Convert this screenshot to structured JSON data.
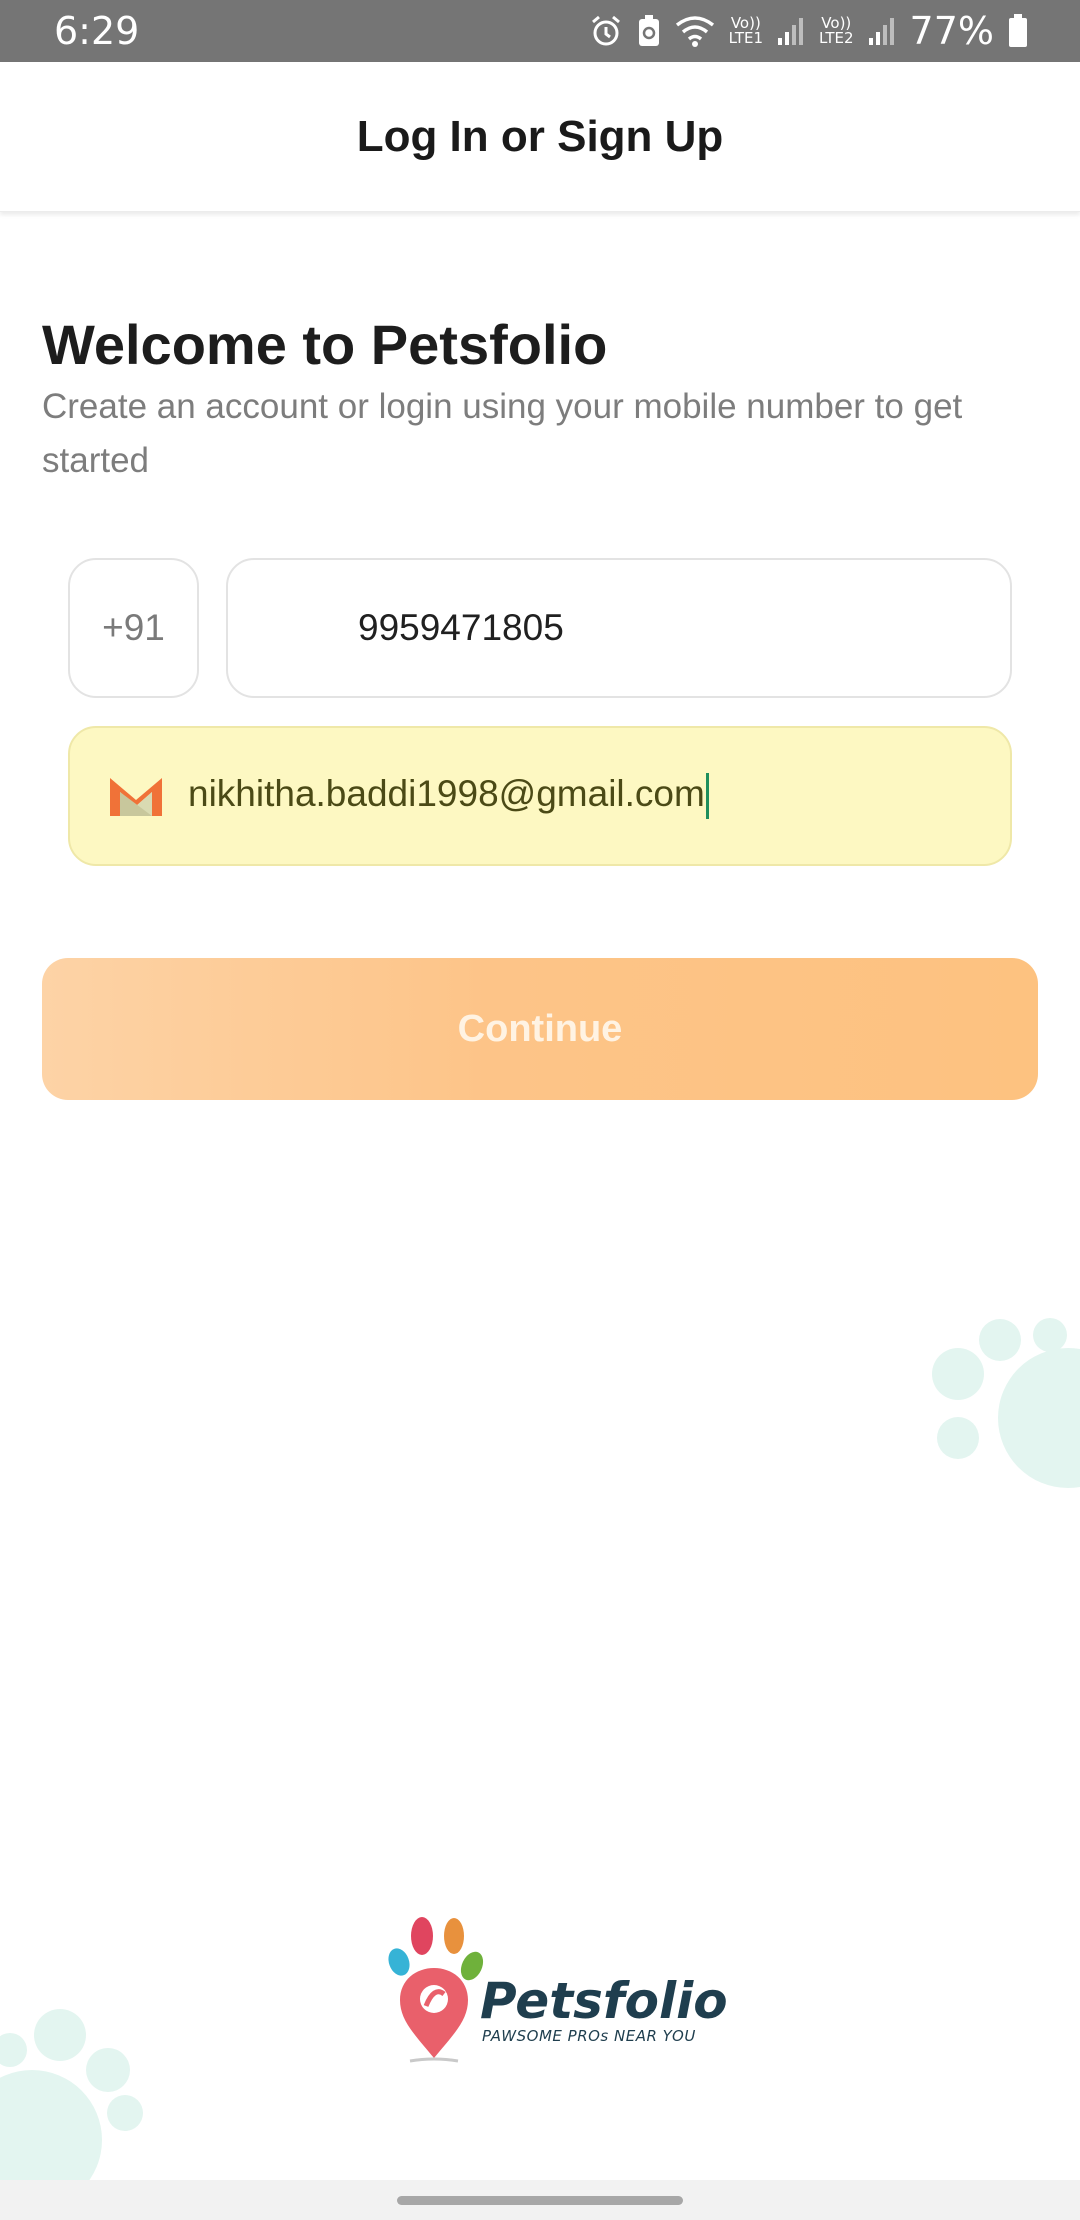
{
  "status_bar": {
    "time": "6:29",
    "sim1_label": "LTE1",
    "sim2_label": "LTE2",
    "volte_label": "Vo))",
    "battery": "77%",
    "icons": [
      "alarm-icon",
      "battery-saver-icon",
      "wifi-icon",
      "signal-icon",
      "battery-icon"
    ]
  },
  "header": {
    "title": "Log In or Sign Up"
  },
  "welcome": {
    "title": "Welcome to Petsfolio",
    "subtitle": "Create an account or login using your mobile number to get started"
  },
  "form": {
    "country_code": "+91",
    "phone": "9959471805",
    "email": "nikhitha.baddi1998@gmail.com",
    "email_icon": "gmail-icon",
    "continue_label": "Continue"
  },
  "logo": {
    "name": "Petsfolio",
    "tagline": "PAWSOME PROs NEAR YOU"
  },
  "colors": {
    "accent": "#fdc488",
    "autofill": "#fdf8c2",
    "paw_decor": "#e3f5f0",
    "logo_text": "#1f3e4e"
  }
}
